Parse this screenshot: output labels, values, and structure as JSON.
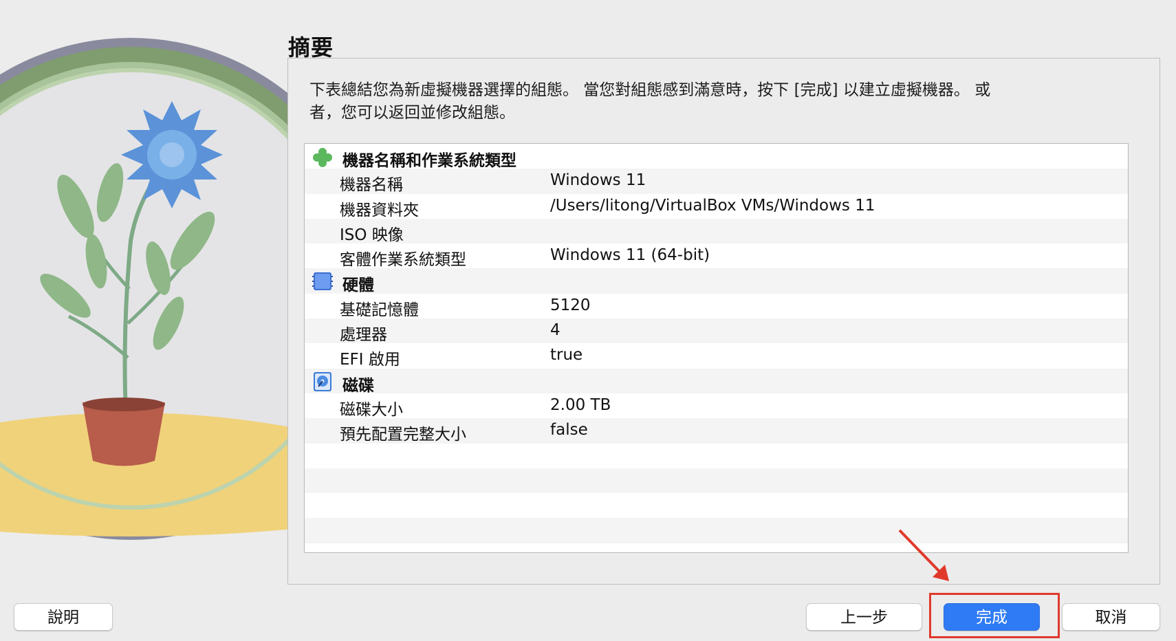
{
  "header": {
    "title": "摘要"
  },
  "description": "下表總結您為新虛擬機器選擇的組態。 當您對組態感到滿意時，按下 [完成] 以建立虛擬機器。 或者，您可以返回並修改組態。",
  "summary": {
    "groups": [
      {
        "icon": "green-puzzle-icon",
        "label": "機器名稱和作業系統類型",
        "rows": [
          {
            "key": "機器名稱",
            "value": "Windows 11"
          },
          {
            "key": "機器資料夾",
            "value": "/Users/litong/VirtualBox VMs/Windows 11"
          },
          {
            "key": "ISO 映像",
            "value": ""
          },
          {
            "key": "客體作業系統類型",
            "value": "Windows 11 (64-bit)"
          }
        ]
      },
      {
        "icon": "chip-icon",
        "label": "硬體",
        "rows": [
          {
            "key": "基礎記憶體",
            "value": "5120"
          },
          {
            "key": "處理器",
            "value": "4"
          },
          {
            "key": "EFI 啟用",
            "value": "true"
          }
        ]
      },
      {
        "icon": "disk-icon",
        "label": "磁碟",
        "rows": [
          {
            "key": "磁碟大小",
            "value": "2.00 TB"
          },
          {
            "key": "預先配置完整大小",
            "value": "false"
          }
        ]
      }
    ]
  },
  "buttons": {
    "help": "說明",
    "back": "上一步",
    "finish": "完成",
    "cancel": "取消"
  },
  "colors": {
    "accent": "#2f7bf5",
    "annotation": "#e0392b"
  }
}
